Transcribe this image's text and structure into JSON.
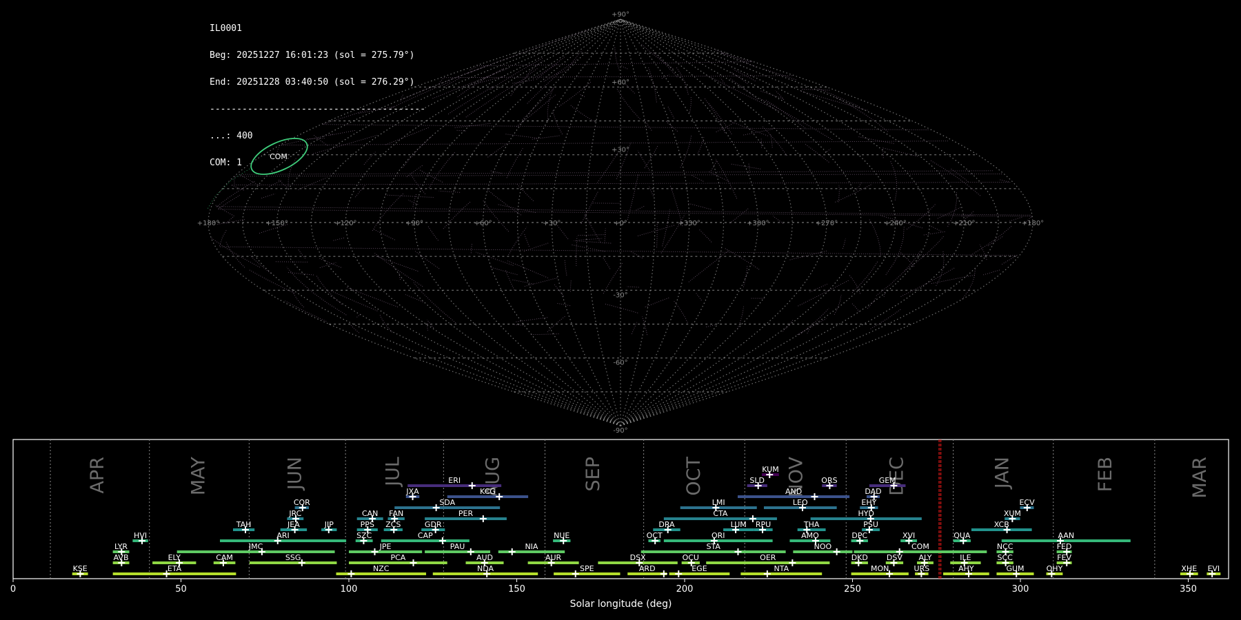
{
  "header": {
    "station": "IL0001",
    "beg": "Beg: 20251227 16:01:23 (sol = 275.79°)",
    "end": "End: 20251228 03:40:50 (sol = 276.29°)",
    "divider": "----------------------------------------",
    "sporadic": "...: 400",
    "com": "COM: 1"
  },
  "colors": {
    "background": "#000000",
    "grid": "#9a9a9a",
    "tracks": "#7d6480",
    "shower_ellipse": "#3fce7c",
    "sol_marker": "#e01818",
    "month_label": "#6b6b6b"
  },
  "sky_map": {
    "projection": "sinusoidal",
    "ra_labels": [
      "+180°",
      "+150°",
      "+120°",
      "+90°",
      "+60°",
      "+30°",
      "+0°",
      "+330°",
      "+300°",
      "+270°",
      "+240°",
      "+210°",
      "+180°"
    ],
    "dec_labels": [
      "+90°",
      "+60°",
      "+30°",
      "+0°",
      "-30°",
      "-60°",
      "-90°"
    ],
    "shower_label": "COM"
  },
  "chart_data": {
    "type": "timeline",
    "xlabel": "Solar longitude (deg)",
    "ylabel": "",
    "xlim": [
      0,
      362
    ],
    "xticks": [
      0,
      50,
      100,
      150,
      200,
      250,
      300,
      350
    ],
    "current_sol": [
      275.79,
      276.29
    ],
    "months": [
      {
        "name": "APR",
        "start": 11.1,
        "center": 24.8
      },
      {
        "name": "MAY",
        "start": 40.6,
        "center": 54.9
      },
      {
        "name": "JUN",
        "start": 70.3,
        "center": 83.7
      },
      {
        "name": "JUL",
        "start": 99.0,
        "center": 112.8
      },
      {
        "name": "AUG",
        "start": 128.2,
        "center": 142.6
      },
      {
        "name": "SEP",
        "start": 158.4,
        "center": 172.5
      },
      {
        "name": "OCT",
        "start": 187.8,
        "center": 202.5
      },
      {
        "name": "NOV",
        "start": 217.9,
        "center": 232.9
      },
      {
        "name": "DEC",
        "start": 248.1,
        "center": 262.9
      },
      {
        "name": "JAN",
        "start": 280.0,
        "center": 294.3
      },
      {
        "name": "FEB",
        "start": 309.8,
        "center": 325.0
      },
      {
        "name": "MAR",
        "start": 340.0,
        "center": 353.2
      }
    ],
    "showers": [
      {
        "code": "KSE",
        "start": 17.6,
        "end": 22.3,
        "peak": 20.0,
        "row": 0
      },
      {
        "code": "ETA",
        "start": 29.7,
        "end": 66.4,
        "peak": 45.7,
        "row": 0
      },
      {
        "code": "NZC",
        "start": 96.2,
        "end": 123.0,
        "peak": 100.7,
        "row": 0
      },
      {
        "code": "NDA",
        "start": 125.0,
        "end": 156.3,
        "peak": 141.1,
        "row": 0
      },
      {
        "code": "SPE",
        "start": 161.0,
        "end": 180.8,
        "peak": 167.5,
        "row": 0
      },
      {
        "code": "ARD",
        "start": 183.0,
        "end": 194.7,
        "peak": 193.8,
        "row": 0
      },
      {
        "code": "EGE",
        "start": 195.4,
        "end": 213.4,
        "peak": 198.2,
        "row": 0
      },
      {
        "code": "NTA",
        "start": 216.7,
        "end": 240.9,
        "peak": 224.6,
        "row": 0
      },
      {
        "code": "MON",
        "start": 249.6,
        "end": 266.7,
        "peak": 261.0,
        "row": 0
      },
      {
        "code": "URS",
        "start": 268.6,
        "end": 272.6,
        "peak": 270.5,
        "row": 0
      },
      {
        "code": "AHY",
        "start": 277.0,
        "end": 290.7,
        "peak": 284.6,
        "row": 0
      },
      {
        "code": "GUM",
        "start": 292.9,
        "end": 304.0,
        "peak": 298.8,
        "row": 0
      },
      {
        "code": "OHY",
        "start": 307.7,
        "end": 312.6,
        "peak": 309.3,
        "row": 0
      },
      {
        "code": "XHE",
        "start": 347.6,
        "end": 352.9,
        "peak": 350.5,
        "row": 0
      },
      {
        "code": "EVI",
        "start": 355.5,
        "end": 359.6,
        "peak": 357.1,
        "row": 0
      },
      {
        "code": "AVB",
        "start": 29.7,
        "end": 34.6,
        "peak": 32.3,
        "row": 1
      },
      {
        "code": "ELY",
        "start": 41.5,
        "end": 54.5,
        "peak": 49.5,
        "row": 1
      },
      {
        "code": "CAM",
        "start": 59.7,
        "end": 66.2,
        "peak": 62.6,
        "row": 1
      },
      {
        "code": "SSG",
        "start": 70.4,
        "end": 96.4,
        "peak": 86.0,
        "row": 1
      },
      {
        "code": "PCA",
        "start": 100.0,
        "end": 129.3,
        "peak": 119.2,
        "row": 1
      },
      {
        "code": "AUD",
        "start": 134.8,
        "end": 146.1,
        "peak": 140.4,
        "row": 1
      },
      {
        "code": "AUR",
        "start": 153.3,
        "end": 168.5,
        "peak": 160.3,
        "row": 1
      },
      {
        "code": "DSX",
        "start": 174.2,
        "end": 197.9,
        "peak": 186.5,
        "row": 1
      },
      {
        "code": "OCU",
        "start": 199.1,
        "end": 204.5,
        "peak": 202.0,
        "row": 1
      },
      {
        "code": "OER",
        "start": 206.4,
        "end": 243.2,
        "peak": 232.1,
        "row": 1
      },
      {
        "code": "DKD",
        "start": 249.6,
        "end": 254.6,
        "peak": 251.8,
        "row": 1
      },
      {
        "code": "DSV",
        "start": 259.9,
        "end": 265.1,
        "peak": 262.3,
        "row": 1
      },
      {
        "code": "ALY",
        "start": 269.2,
        "end": 274.1,
        "peak": 271.4,
        "row": 1
      },
      {
        "code": "ILE",
        "start": 279.1,
        "end": 288.2,
        "peak": 283.3,
        "row": 1
      },
      {
        "code": "SCC",
        "start": 292.9,
        "end": 297.9,
        "peak": 295.6,
        "row": 1
      },
      {
        "code": "FEV",
        "start": 310.8,
        "end": 315.3,
        "peak": 313.8,
        "row": 1
      },
      {
        "code": "LYR",
        "start": 29.7,
        "end": 34.6,
        "peak": 32.3,
        "row": 2
      },
      {
        "code": "JMC",
        "start": 48.8,
        "end": 95.8,
        "peak": 74.1,
        "row": 2
      },
      {
        "code": "JPE",
        "start": 100.0,
        "end": 121.8,
        "peak": 107.7,
        "row": 2
      },
      {
        "code": "PAU",
        "start": 122.6,
        "end": 142.1,
        "peak": 136.3,
        "row": 2
      },
      {
        "code": "NIA",
        "start": 144.5,
        "end": 164.3,
        "peak": 148.6,
        "row": 2
      },
      {
        "code": "STA",
        "start": 187.0,
        "end": 230.1,
        "peak": 215.9,
        "row": 2
      },
      {
        "code": "NOO",
        "start": 232.3,
        "end": 250.0,
        "peak": 245.3,
        "row": 2
      },
      {
        "code": "COM",
        "start": 250.4,
        "end": 290.0,
        "peak": 264.0,
        "row": 2
      },
      {
        "code": "NCC",
        "start": 292.9,
        "end": 297.9,
        "peak": 295.6,
        "row": 2
      },
      {
        "code": "FED",
        "start": 310.8,
        "end": 315.3,
        "peak": 313.8,
        "row": 2
      },
      {
        "code": "HVI",
        "start": 35.6,
        "end": 40.2,
        "peak": 38.4,
        "row": 3
      },
      {
        "code": "ARI",
        "start": 61.6,
        "end": 99.2,
        "peak": 78.8,
        "row": 3
      },
      {
        "code": "SZC",
        "start": 102.0,
        "end": 107.1,
        "peak": 104.4,
        "row": 3
      },
      {
        "code": "CAP",
        "start": 109.6,
        "end": 135.9,
        "peak": 127.9,
        "row": 3
      },
      {
        "code": "NUE",
        "start": 160.8,
        "end": 166.0,
        "peak": 163.9,
        "row": 3
      },
      {
        "code": "OCT",
        "start": 189.2,
        "end": 192.8,
        "peak": 191.2,
        "row": 3
      },
      {
        "code": "ORI",
        "start": 193.8,
        "end": 226.2,
        "peak": 208.8,
        "row": 3
      },
      {
        "code": "AMO",
        "start": 231.3,
        "end": 243.4,
        "peak": 239.0,
        "row": 3
      },
      {
        "code": "DPC",
        "start": 249.6,
        "end": 254.6,
        "peak": 252.2,
        "row": 3
      },
      {
        "code": "XVI",
        "start": 264.3,
        "end": 269.2,
        "peak": 266.8,
        "row": 3
      },
      {
        "code": "QUA",
        "start": 280.0,
        "end": 285.2,
        "peak": 283.0,
        "row": 3
      },
      {
        "code": "AAN",
        "start": 294.4,
        "end": 332.8,
        "peak": 311.9,
        "row": 3
      },
      {
        "code": "TAH",
        "start": 65.5,
        "end": 71.9,
        "peak": 69.2,
        "row": 4
      },
      {
        "code": "JEA",
        "start": 79.6,
        "end": 87.5,
        "peak": 83.9,
        "row": 4
      },
      {
        "code": "JIP",
        "start": 91.8,
        "end": 96.4,
        "peak": 94.0,
        "row": 4
      },
      {
        "code": "PPS",
        "start": 102.4,
        "end": 108.6,
        "peak": 105.6,
        "row": 4
      },
      {
        "code": "ZCS",
        "start": 110.4,
        "end": 116.0,
        "peak": 113.4,
        "row": 4
      },
      {
        "code": "GDR",
        "start": 121.6,
        "end": 128.6,
        "peak": 125.8,
        "row": 4
      },
      {
        "code": "DRA",
        "start": 190.6,
        "end": 198.7,
        "peak": 195.0,
        "row": 4
      },
      {
        "code": "LUM",
        "start": 211.5,
        "end": 220.6,
        "peak": 215.2,
        "row": 4
      },
      {
        "code": "RPU",
        "start": 220.6,
        "end": 226.2,
        "peak": 223.2,
        "row": 4
      },
      {
        "code": "THA",
        "start": 233.6,
        "end": 242.0,
        "peak": 236.4,
        "row": 4
      },
      {
        "code": "PSU",
        "start": 252.8,
        "end": 258.1,
        "peak": 255.0,
        "row": 4
      },
      {
        "code": "XCB",
        "start": 285.4,
        "end": 303.4,
        "peak": 296.0,
        "row": 4
      },
      {
        "code": "JRC",
        "start": 81.6,
        "end": 86.5,
        "peak": 84.2,
        "row": 5
      },
      {
        "code": "CAN",
        "start": 102.4,
        "end": 110.2,
        "peak": 107.0,
        "row": 5
      },
      {
        "code": "FAN",
        "start": 111.6,
        "end": 116.6,
        "peak": 113.6,
        "row": 5
      },
      {
        "code": "PER",
        "start": 122.6,
        "end": 147.0,
        "peak": 140.0,
        "row": 5
      },
      {
        "code": "CTA",
        "start": 193.8,
        "end": 227.5,
        "peak": 220.3,
        "row": 5
      },
      {
        "code": "HYD",
        "start": 237.5,
        "end": 270.6,
        "peak": 255.4,
        "row": 5
      },
      {
        "code": "XUM",
        "start": 295.3,
        "end": 299.9,
        "peak": 297.6,
        "row": 5
      },
      {
        "code": "COR",
        "start": 83.9,
        "end": 88.1,
        "peak": 86.2,
        "row": 6
      },
      {
        "code": "SDA",
        "start": 113.6,
        "end": 145.0,
        "peak": 126.0,
        "row": 6
      },
      {
        "code": "LMI",
        "start": 198.7,
        "end": 221.5,
        "peak": 209.3,
        "row": 6
      },
      {
        "code": "LEO",
        "start": 223.6,
        "end": 245.3,
        "peak": 235.1,
        "row": 6
      },
      {
        "code": "EHY",
        "start": 252.2,
        "end": 257.6,
        "peak": 255.6,
        "row": 6
      },
      {
        "code": "ECV",
        "start": 299.9,
        "end": 304.0,
        "peak": 302.0,
        "row": 6
      },
      {
        "code": "JXA",
        "start": 117.0,
        "end": 121.0,
        "peak": 119.0,
        "row": 7
      },
      {
        "code": "KCG",
        "start": 129.3,
        "end": 153.4,
        "peak": 144.8,
        "row": 7
      },
      {
        "code": "AND",
        "start": 215.8,
        "end": 249.1,
        "peak": 238.7,
        "row": 7
      },
      {
        "code": "DAD",
        "start": 254.2,
        "end": 258.1,
        "peak": 256.4,
        "row": 7
      },
      {
        "code": "ERI",
        "start": 117.5,
        "end": 145.4,
        "peak": 136.7,
        "row": 8
      },
      {
        "code": "SLD",
        "start": 218.6,
        "end": 224.6,
        "peak": 221.9,
        "row": 8
      },
      {
        "code": "ORS",
        "start": 240.9,
        "end": 245.3,
        "peak": 243.2,
        "row": 8
      },
      {
        "code": "GEM",
        "start": 255.0,
        "end": 265.8,
        "peak": 262.3,
        "row": 8
      },
      {
        "code": "KUM",
        "start": 223.0,
        "end": 228.1,
        "peak": 225.3,
        "row": 9
      }
    ]
  }
}
